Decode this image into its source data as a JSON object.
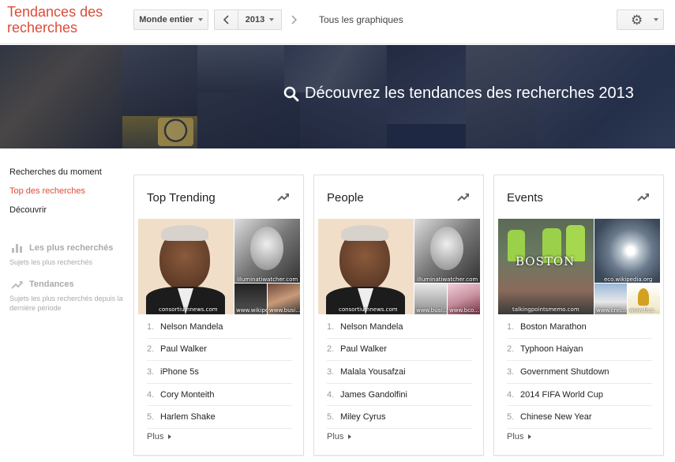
{
  "header": {
    "logo_line1": "Tendances des",
    "logo_line2": "recherches",
    "region_label": "Monde entier",
    "year_label": "2013",
    "all_charts_label": "Tous les graphiques"
  },
  "banner": {
    "title": "Découvrez les tendances des recherches 2013"
  },
  "sidebar": {
    "links": [
      "Recherches du moment",
      "Top des recherches",
      "Découvrir"
    ],
    "section1_title": "Les plus recherchés",
    "section1_sub": "Sujets les plus recherchés",
    "section2_title": "Tendances",
    "section2_sub": "Sujets les plus recherchés depuis la dernière période"
  },
  "cards": [
    {
      "title": "Top Trending",
      "items": [
        "Nelson Mandela",
        "Paul Walker",
        "iPhone 5s",
        "Cory Monteith",
        "Harlem Shake"
      ],
      "credits": [
        "consortiumnews.com",
        "illuminatiwatcher.com",
        "www.wikipe...",
        "www.busi..."
      ],
      "more": "Plus"
    },
    {
      "title": "People",
      "items": [
        "Nelson Mandela",
        "Paul Walker",
        "Malala Yousafzai",
        "James Gandolfini",
        "Miley Cyrus"
      ],
      "credits": [
        "consortiumnews.com",
        "illuminatiwatcher.com",
        "www.busi...",
        "www.bco..."
      ],
      "more": "Plus"
    },
    {
      "title": "Events",
      "items": [
        "Boston Marathon",
        "Typhoon Haiyan",
        "Government Shutdown",
        "2014 FIFA World Cup",
        "Chinese New Year"
      ],
      "credits": [
        "talkingpointsmemo.com",
        "eco.wikipedia.org",
        "www.cnn....",
        "www.bus..."
      ],
      "more": "Plus",
      "image_text": "BOSTON"
    }
  ],
  "numbers": [
    "1.",
    "2.",
    "3.",
    "4.",
    "5."
  ],
  "colors": {
    "brand": "#dd4b39",
    "banner": "#1e2638"
  }
}
